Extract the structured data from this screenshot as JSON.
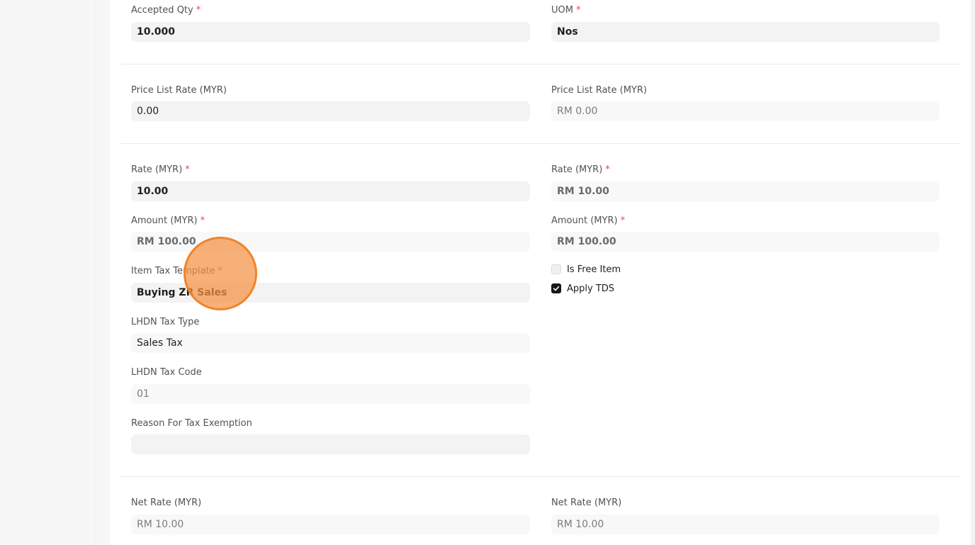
{
  "fields": {
    "accepted_qty": {
      "label": "Accepted Qty",
      "required": "*",
      "value": "10.000"
    },
    "uom": {
      "label": "UOM",
      "required": "*",
      "value": "Nos"
    },
    "price_list_rate": {
      "label": "Price List Rate (MYR)",
      "value": "0.00"
    },
    "base_price_list_rate": {
      "label": "Price List Rate (MYR)",
      "value": "RM 0.00"
    },
    "rate": {
      "label": "Rate (MYR)",
      "required": "*",
      "value": "10.00"
    },
    "base_rate": {
      "label": "Rate (MYR)",
      "required": "*",
      "value": "RM 10.00"
    },
    "amount": {
      "label": "Amount (MYR)",
      "required": "*",
      "value": "RM 100.00"
    },
    "base_amount": {
      "label": "Amount (MYR)",
      "required": "*",
      "value": "RM 100.00"
    },
    "item_tax_template": {
      "label": "Item Tax Template",
      "required": "*",
      "value": "Buying ZR Sales"
    },
    "lhdn_tax_type": {
      "label": "LHDN Tax Type",
      "value": "Sales Tax"
    },
    "lhdn_tax_code": {
      "label": "LHDN Tax Code",
      "value": "01"
    },
    "reason_tax_exemption": {
      "label": "Reason For Tax Exemption",
      "value": ""
    },
    "net_rate": {
      "label": "Net Rate (MYR)",
      "value": "RM 10.00"
    },
    "base_net_rate": {
      "label": "Net Rate (MYR)",
      "value": "RM 10.00"
    }
  },
  "checks": {
    "is_free_item": {
      "label": "Is Free Item",
      "checked": false
    },
    "apply_tds": {
      "label": "Apply TDS",
      "checked": true
    }
  },
  "colors": {
    "required_marker": "#e5484d",
    "cursor_highlight": "#f49242",
    "checkbox_checked": "#171717"
  }
}
